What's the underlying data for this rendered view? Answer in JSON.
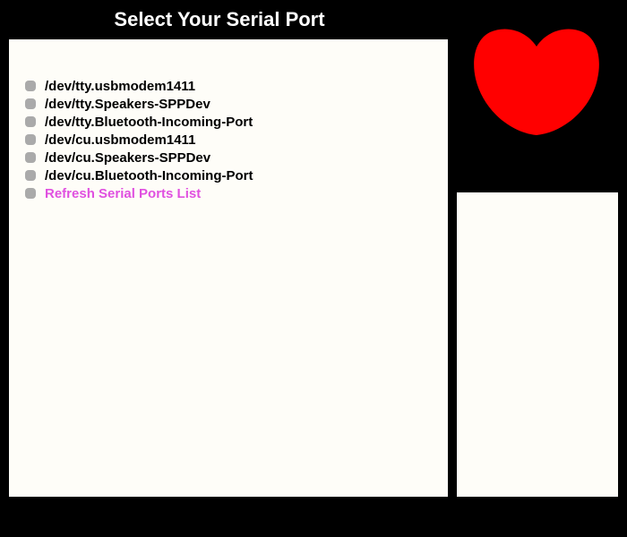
{
  "header": {
    "title": "Select Your Serial Port"
  },
  "serial_ports": {
    "items": [
      {
        "label": "/dev/tty.usbmodem1411"
      },
      {
        "label": "/dev/tty.Speakers-SPPDev"
      },
      {
        "label": "/dev/tty.Bluetooth-Incoming-Port"
      },
      {
        "label": "/dev/cu.usbmodem1411"
      },
      {
        "label": "/dev/cu.Speakers-SPPDev"
      },
      {
        "label": "/dev/cu.Bluetooth-Incoming-Port"
      }
    ],
    "refresh_label": "Refresh Serial Ports List"
  },
  "heart": {
    "icon": "heart-icon",
    "color": "#ff0000"
  },
  "colors": {
    "background": "#000000",
    "panel": "#fefdf8",
    "bullet": "#aaaaaa",
    "refresh_link": "#e050e0",
    "title_text": "#ffffff"
  }
}
